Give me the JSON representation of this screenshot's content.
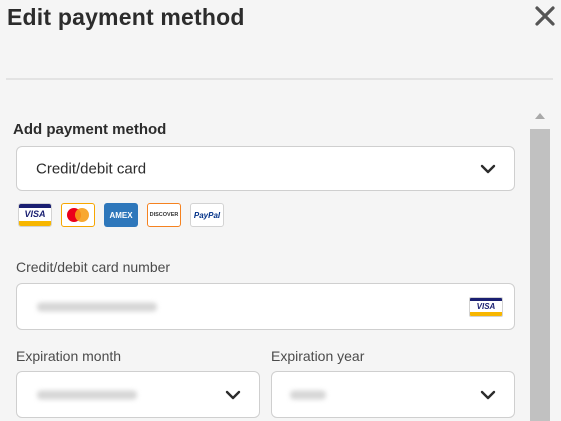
{
  "dialog": {
    "title": "Edit payment method",
    "close_icon": "close-icon"
  },
  "form": {
    "section_label": "Add payment method",
    "method_select": {
      "value": "Credit/debit card",
      "icon": "chevron-down-icon"
    },
    "card_logos": [
      {
        "name": "visa",
        "text": "VISA",
        "color": "#1a1f71"
      },
      {
        "name": "mastercard",
        "text": "",
        "color": "#eb001b"
      },
      {
        "name": "amex",
        "text": "AMEX",
        "color": "#2e77bb"
      },
      {
        "name": "discover",
        "text": "DISCOVER",
        "color": "#f58220"
      },
      {
        "name": "paypal",
        "text": "PayPal",
        "color": "#003087"
      }
    ],
    "card_number": {
      "label": "Credit/debit card number",
      "value_blurred": true,
      "brand_icon": "visa-icon"
    },
    "expiration_month": {
      "label": "Expiration month",
      "value_blurred": true,
      "icon": "chevron-down-icon"
    },
    "expiration_year": {
      "label": "Expiration year",
      "value_blurred": true,
      "icon": "chevron-down-icon"
    }
  },
  "colors": {
    "background": "#f5f5f5",
    "field_bg": "#ffffff",
    "border": "#cfcfcf",
    "text": "#2c2c2c",
    "scrollbar_thumb": "#c1c1c1"
  }
}
